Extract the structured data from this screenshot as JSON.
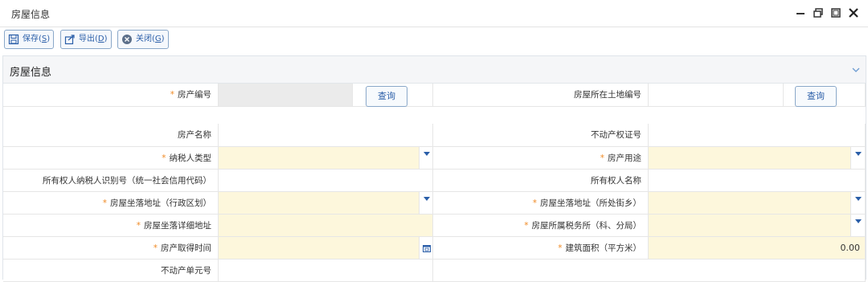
{
  "window": {
    "title": "房屋信息"
  },
  "toolbar": {
    "save_label": "保存(",
    "save_key": "S",
    "export_label": "导出(",
    "export_key": "D",
    "close_label": "关闭(",
    "close_key": "G",
    "paren_close": ")"
  },
  "panel": {
    "title": "房屋信息"
  },
  "fields": {
    "house_no": {
      "label": "房产编号",
      "required": "*"
    },
    "land_no": {
      "label": "房屋所在土地编号"
    },
    "query_label": "查询",
    "house_name": {
      "label": "房产名称"
    },
    "cert_no": {
      "label": "不动产权证号"
    },
    "taxpayer_type": {
      "label": "纳税人类型",
      "required": "*"
    },
    "house_use": {
      "label": "房产用途",
      "required": "*"
    },
    "owner_tax_id": {
      "label": "所有权人纳税人识别号（统一社会信用代码）"
    },
    "owner_name": {
      "label": "所有权人名称"
    },
    "addr_admin": {
      "label": "房屋坐落地址（行政区划）",
      "required": "*"
    },
    "addr_street": {
      "label": "房屋坐落地址（所处街乡）",
      "required": "*"
    },
    "addr_detail": {
      "label": "房屋坐落详细地址",
      "required": "*"
    },
    "tax_office": {
      "label": "房屋所属税务所（科、分局）",
      "required": "*"
    },
    "acquire_date": {
      "label": "房产取得时间",
      "required": "*"
    },
    "build_area": {
      "label": "建筑面积（平方米）",
      "required": "*",
      "value": "0.00"
    },
    "unit_no": {
      "label": "不动产单元号"
    }
  },
  "colors": {
    "accent": "#2a5ea8",
    "required": "#f08a24",
    "field_highlight": "#fdf7dc"
  }
}
